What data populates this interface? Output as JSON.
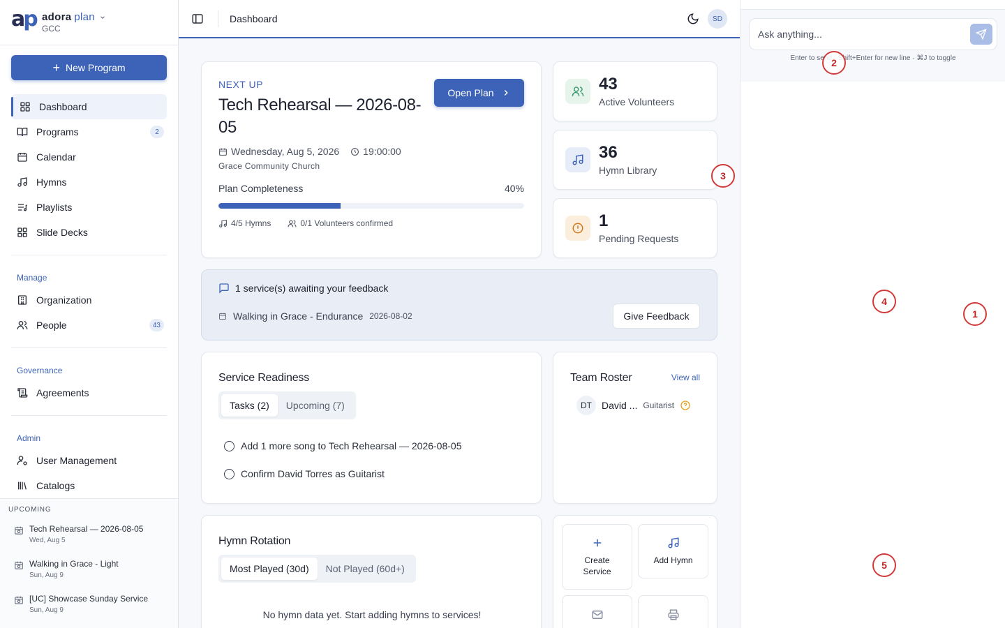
{
  "brand": {
    "logo": "ap",
    "name": "adora",
    "plan": "plan",
    "org": "GCC"
  },
  "sidebar": {
    "new_program": "New Program",
    "items": [
      {
        "label": "Dashboard",
        "icon": "dashboard-icon",
        "active": true
      },
      {
        "label": "Programs",
        "icon": "book-icon",
        "badge": "2"
      },
      {
        "label": "Calendar",
        "icon": "calendar-icon"
      },
      {
        "label": "Hymns",
        "icon": "music-icon"
      },
      {
        "label": "Playlists",
        "icon": "playlist-icon"
      },
      {
        "label": "Slide Decks",
        "icon": "grid-icon"
      }
    ],
    "manage_label": "Manage",
    "manage": [
      {
        "label": "Organization",
        "icon": "building-icon"
      },
      {
        "label": "People",
        "icon": "users-icon",
        "badge": "43"
      }
    ],
    "governance_label": "Governance",
    "governance": [
      {
        "label": "Agreements",
        "icon": "scroll-icon"
      }
    ],
    "admin_label": "Admin",
    "admin": [
      {
        "label": "User Management",
        "icon": "user-cog-icon"
      },
      {
        "label": "Catalogs",
        "icon": "library-icon"
      }
    ],
    "upcoming_label": "UPCOMING",
    "upcoming": [
      {
        "title": "Tech Rehearsal — 2026-08-05",
        "date": "Wed, Aug 5"
      },
      {
        "title": "Walking in Grace - Light",
        "date": "Sun, Aug 9"
      },
      {
        "title": "[UC] Showcase Sunday Service",
        "date": "Sun, Aug 9"
      }
    ]
  },
  "topbar": {
    "breadcrumb": "Dashboard",
    "avatar": "SD"
  },
  "next_up": {
    "label": "NEXT UP",
    "title": "Tech Rehearsal — 2026-08-05",
    "date": "Wednesday, Aug 5, 2026",
    "time": "19:00:00",
    "org": "Grace Community Church",
    "open_plan": "Open Plan",
    "completeness_label": "Plan Completeness",
    "completeness_text": "40%",
    "completeness_value": 0.4,
    "hymns": "4/5 Hymns",
    "volunteers": "0/1 Volunteers confirmed"
  },
  "stats": [
    {
      "value": "43",
      "label": "Active Volunteers",
      "icon": "users-icon",
      "color": "#3f9a6e",
      "bg": "#e6f4ec"
    },
    {
      "value": "36",
      "label": "Hymn Library",
      "icon": "music-icon",
      "color": "#3d63b8",
      "bg": "#e7edf8"
    },
    {
      "value": "1",
      "label": "Pending Requests",
      "icon": "alert-circle-icon",
      "color": "#d27a1f",
      "bg": "#fbeedd"
    }
  ],
  "feedback": {
    "title": "1 service(s) awaiting your feedback",
    "service": "Walking in Grace - Endurance",
    "date": "2026-08-02",
    "button": "Give Feedback"
  },
  "readiness": {
    "title": "Service Readiness",
    "tabs": [
      "Tasks (2)",
      "Upcoming (7)"
    ],
    "tasks": [
      "Add 1 more song to Tech Rehearsal — 2026-08-05",
      "Confirm David Torres as Guitarist"
    ]
  },
  "roster": {
    "title": "Team Roster",
    "view_all": "View all",
    "members": [
      {
        "initials": "DT",
        "name": "David ...",
        "role": "Guitarist"
      }
    ]
  },
  "hymn_rotation": {
    "title": "Hymn Rotation",
    "tabs": [
      "Most Played (30d)",
      "Not Played (60d+)"
    ],
    "empty": "No hymn data yet. Start adding hymns to services!"
  },
  "quick_actions": {
    "create_service": [
      "Create",
      "Service"
    ],
    "add_hymn": "Add Hymn"
  },
  "chat": {
    "placeholder": "Ask anything...",
    "hint": "Enter to send · Shift+Enter for new line · ⌘J to toggle"
  },
  "markers": [
    "1",
    "2",
    "3",
    "4",
    "5"
  ],
  "colors": {
    "accent": "#3d63b8",
    "marker": "#d23a3a"
  }
}
